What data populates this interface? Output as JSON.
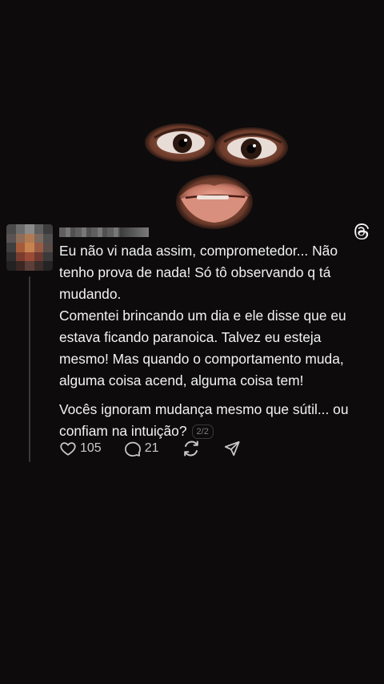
{
  "post": {
    "paragraphs": [
      "Eu não vi nada assim, comprometedor... Não tenho prova de nada! Só tô observando q tá mudando.",
      "Comentei brincando um dia e ele disse que eu estava ficando paranoica. Talvez eu esteja mesmo! Mas quando o comportamento muda, alguma coisa acend, alguma coisa tem!",
      "Vocês ignoram mudança mesmo que sútil... ou confiam na intuição?"
    ],
    "page_indicator": "2/2"
  },
  "actions": {
    "likes": "105",
    "replies": "21"
  },
  "icons": {
    "like": "heart-icon",
    "reply": "speech-bubble-icon",
    "repost": "repost-icon",
    "share": "send-icon",
    "app": "threads-logo-icon"
  },
  "colors": {
    "background": "#0d0b0c",
    "text": "#f3f3f3",
    "muted": "#c9c9c9"
  }
}
